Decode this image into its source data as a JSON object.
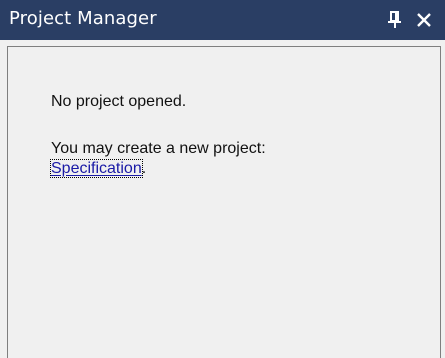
{
  "window": {
    "title": "Project Manager",
    "pin_icon": "pin-icon",
    "close_icon": "close-icon",
    "title_bg": "#2a3e64"
  },
  "content": {
    "no_project": "No project opened.",
    "create_prompt": "You may create a new project:",
    "link_label": "Specification",
    "link_suffix": ".",
    "link_color": "#1a1aa6"
  }
}
